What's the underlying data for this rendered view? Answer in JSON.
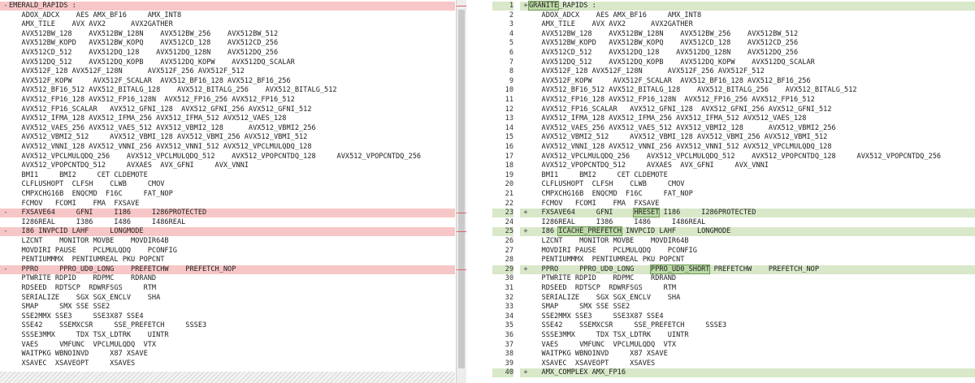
{
  "left_lines": [
    {
      "m": "-",
      "t": "EMERALD_RAPIDS :",
      "c": true
    },
    {
      "m": "",
      "t": "   ADOX_ADCX    AES AMX_BF16     AMX_INT8",
      "c": false
    },
    {
      "m": "",
      "t": "   AMX_TILE    AVX AVX2      AVX2GATHER",
      "c": false
    },
    {
      "m": "",
      "t": "   AVX512BW_128    AVX512BW_128N    AVX512BW_256    AVX512BW_512",
      "c": false
    },
    {
      "m": "",
      "t": "   AVX512BW_KOPD   AVX512BW_KOPQ    AVX512CD_128    AVX512CD_256",
      "c": false
    },
    {
      "m": "",
      "t": "   AVX512CD_512    AVX512DQ_128    AVX512DQ_128N    AVX512DQ_256",
      "c": false
    },
    {
      "m": "",
      "t": "   AVX512DQ_512    AVX512DQ_KOPB    AVX512DQ_KOPW    AVX512DQ_SCALAR",
      "c": false
    },
    {
      "m": "",
      "t": "   AVX512F_128 AVX512F_128N      AVX512F_256 AVX512F_512",
      "c": false
    },
    {
      "m": "",
      "t": "   AVX512F_KOPW     AVX512F_SCALAR  AVX512_BF16_128 AVX512_BF16_256",
      "c": false
    },
    {
      "m": "",
      "t": "   AVX512_BF16_512 AVX512_BITALG_128    AVX512_BITALG_256    AVX512_BITALG_512",
      "c": false
    },
    {
      "m": "",
      "t": "   AVX512_FP16_128 AVX512_FP16_128N  AVX512_FP16_256 AVX512_FP16_512",
      "c": false
    },
    {
      "m": "",
      "t": "   AVX512_FP16_SCALAR   AVX512_GFNI_128  AVX512_GFNI_256 AVX512_GFNI_512",
      "c": false
    },
    {
      "m": "",
      "t": "   AVX512_IFMA_128 AVX512_IFMA_256 AVX512_IFMA_512 AVX512_VAES_128",
      "c": false
    },
    {
      "m": "",
      "t": "   AVX512_VAES_256 AVX512_VAES_512 AVX512_VBMI2_128      AVX512_VBMI2_256",
      "c": false
    },
    {
      "m": "",
      "t": "   AVX512_VBMI2_512     AVX512_VBMI_128 AVX512_VBMI_256 AVX512_VBMI_512",
      "c": false
    },
    {
      "m": "",
      "t": "   AVX512_VNNI_128 AVX512_VNNI_256 AVX512_VNNI_512 AVX512_VPCLMULQDQ_128",
      "c": false
    },
    {
      "m": "",
      "t": "   AVX512_VPCLMULQDQ_256    AVX512_VPCLMULQDQ_512    AVX512_VPOPCNTDQ_128     AVX512_VPOPCNTDQ_256",
      "c": false
    },
    {
      "m": "",
      "t": "   AVX512_VPOPCNTDQ_512     AVXAES  AVX_GFNI     AVX_VNNI",
      "c": false
    },
    {
      "m": "",
      "t": "   BMI1     BMI2     CET CLDEMOTE",
      "c": false
    },
    {
      "m": "",
      "t": "   CLFLUSHOPT  CLFSH    CLWB     CMOV",
      "c": false
    },
    {
      "m": "",
      "t": "   CMPXCHG16B  ENQCMD  F16C     FAT_NOP",
      "c": false
    },
    {
      "m": "",
      "t": "   FCMOV   FCOMI    FMA  FXSAVE",
      "c": false
    },
    {
      "m": "-",
      "t": "   FXSAVE64     GFNI     I186     I286PROTECTED",
      "c": true
    },
    {
      "m": "",
      "t": "   I286REAL     I386     I486     I486REAL",
      "c": false
    },
    {
      "m": "-",
      "t": "   I86 INVPCID LAHF     LONGMODE",
      "c": true
    },
    {
      "m": "",
      "t": "   LZCNT    MONITOR MOVBE    MOVDIR64B",
      "c": false
    },
    {
      "m": "",
      "t": "   MOVDIRI PAUSE    PCLMULQDQ    PCONFIG",
      "c": false
    },
    {
      "m": "",
      "t": "   PENTIUMMMX  PENTIUMREAL PKU POPCNT",
      "c": false
    },
    {
      "m": "-",
      "t": "   PPRO     PPRO_UD0_LONG    PREFETCHW    PREFETCH_NOP",
      "c": true
    },
    {
      "m": "",
      "t": "   PTWRITE RDPID    RDPMC    RDRAND",
      "c": false
    },
    {
      "m": "",
      "t": "   RDSEED  RDTSCP  RDWRFSGS     RTM",
      "c": false
    },
    {
      "m": "",
      "t": "   SERIALIZE    SGX SGX_ENCLV    SHA",
      "c": false
    },
    {
      "m": "",
      "t": "   SMAP     SMX SSE SSE2",
      "c": false
    },
    {
      "m": "",
      "t": "   SSE2MMX SSE3     SSE3X87 SSE4",
      "c": false
    },
    {
      "m": "",
      "t": "   SSE42    SSEMXCSR     SSE_PREFETCH     SSSE3",
      "c": false
    },
    {
      "m": "",
      "t": "   SSSE3MMX     TDX TSX_LDTRK    UINTR",
      "c": false
    },
    {
      "m": "",
      "t": "   VAES     VMFUNC  VPCLMULQDQ  VTX",
      "c": false
    },
    {
      "m": "",
      "t": "   WAITPKG WBNOINVD     X87 XSAVE",
      "c": false
    },
    {
      "m": "",
      "t": "   XSAVEC  XSAVEOPT     XSAVES",
      "c": false
    }
  ],
  "right_lines": [
    {
      "n": "1",
      "m": "+",
      "t": "GRANITE_RAPIDS :",
      "c": true
    },
    {
      "n": "2",
      "m": "",
      "t": "   ADOX_ADCX    AES AMX_BF16     AMX_INT8",
      "c": false
    },
    {
      "n": "3",
      "m": "",
      "t": "   AMX_TILE    AVX AVX2      AVX2GATHER",
      "c": false
    },
    {
      "n": "4",
      "m": "",
      "t": "   AVX512BW_128    AVX512BW_128N    AVX512BW_256    AVX512BW_512",
      "c": false
    },
    {
      "n": "5",
      "m": "",
      "t": "   AVX512BW_KOPD   AVX512BW_KOPQ    AVX512CD_128    AVX512CD_256",
      "c": false
    },
    {
      "n": "6",
      "m": "",
      "t": "   AVX512CD_512    AVX512DQ_128    AVX512DQ_128N    AVX512DQ_256",
      "c": false
    },
    {
      "n": "7",
      "m": "",
      "t": "   AVX512DQ_512    AVX512DQ_KOPB    AVX512DQ_KOPW    AVX512DQ_SCALAR",
      "c": false
    },
    {
      "n": "8",
      "m": "",
      "t": "   AVX512F_128 AVX512F_128N      AVX512F_256 AVX512F_512",
      "c": false
    },
    {
      "n": "9",
      "m": "",
      "t": "   AVX512F_KOPW     AVX512F_SCALAR  AVX512_BF16_128 AVX512_BF16_256",
      "c": false
    },
    {
      "n": "10",
      "m": "",
      "t": "   AVX512_BF16_512 AVX512_BITALG_128    AVX512_BITALG_256    AVX512_BITALG_512",
      "c": false
    },
    {
      "n": "11",
      "m": "",
      "t": "   AVX512_FP16_128 AVX512_FP16_128N  AVX512_FP16_256 AVX512_FP16_512",
      "c": false
    },
    {
      "n": "12",
      "m": "",
      "t": "   AVX512_FP16_SCALAR   AVX512_GFNI_128  AVX512_GFNI_256 AVX512_GFNI_512",
      "c": false
    },
    {
      "n": "13",
      "m": "",
      "t": "   AVX512_IFMA_128 AVX512_IFMA_256 AVX512_IFMA_512 AVX512_VAES_128",
      "c": false
    },
    {
      "n": "14",
      "m": "",
      "t": "   AVX512_VAES_256 AVX512_VAES_512 AVX512_VBMI2_128      AVX512_VBMI2_256",
      "c": false
    },
    {
      "n": "15",
      "m": "",
      "t": "   AVX512_VBMI2_512     AVX512_VBMI_128 AVX512_VBMI_256 AVX512_VBMI_512",
      "c": false
    },
    {
      "n": "16",
      "m": "",
      "t": "   AVX512_VNNI_128 AVX512_VNNI_256 AVX512_VNNI_512 AVX512_VPCLMULQDQ_128",
      "c": false
    },
    {
      "n": "17",
      "m": "",
      "t": "   AVX512_VPCLMULQDQ_256    AVX512_VPCLMULQDQ_512    AVX512_VPOPCNTDQ_128     AVX512_VPOPCNTDQ_256",
      "c": false
    },
    {
      "n": "18",
      "m": "",
      "t": "   AVX512_VPOPCNTDQ_512     AVXAES  AVX_GFNI     AVX_VNNI",
      "c": false
    },
    {
      "n": "19",
      "m": "",
      "t": "   BMI1     BMI2     CET CLDEMOTE",
      "c": false
    },
    {
      "n": "20",
      "m": "",
      "t": "   CLFLUSHOPT  CLFSH    CLWB     CMOV",
      "c": false
    },
    {
      "n": "21",
      "m": "",
      "t": "   CMPXCHG16B  ENQCMD  F16C     FAT_NOP",
      "c": false
    },
    {
      "n": "22",
      "m": "",
      "t": "   FCMOV   FCOMI    FMA  FXSAVE",
      "c": false
    },
    {
      "n": "23",
      "m": "+",
      "t": "   FXSAVE64     GFNI     HRESET I186     I286PROTECTED",
      "c": true
    },
    {
      "n": "24",
      "m": "",
      "t": "   I286REAL     I386     I486     I486REAL",
      "c": false
    },
    {
      "n": "25",
      "m": "+",
      "t": "   I86 ICACHE_PREFETCH INVPCID LAHF     LONGMODE",
      "c": true
    },
    {
      "n": "26",
      "m": "",
      "t": "   LZCNT    MONITOR MOVBE    MOVDIR64B",
      "c": false
    },
    {
      "n": "27",
      "m": "",
      "t": "   MOVDIRI PAUSE    PCLMULQDQ    PCONFIG",
      "c": false
    },
    {
      "n": "28",
      "m": "",
      "t": "   PENTIUMMMX  PENTIUMREAL PKU POPCNT",
      "c": false
    },
    {
      "n": "29",
      "m": "+",
      "t": "   PPRO     PPRO_UD0_LONG    PPRO_UD0_SHORT PREFETCHW    PREFETCH_NOP",
      "c": true
    },
    {
      "n": "30",
      "m": "",
      "t": "   PTWRITE RDPID    RDPMC    RDRAND",
      "c": false
    },
    {
      "n": "31",
      "m": "",
      "t": "   RDSEED  RDTSCP  RDWRFSGS     RTM",
      "c": false
    },
    {
      "n": "32",
      "m": "",
      "t": "   SERIALIZE    SGX SGX_ENCLV    SHA",
      "c": false
    },
    {
      "n": "33",
      "m": "",
      "t": "   SMAP     SMX SSE SSE2",
      "c": false
    },
    {
      "n": "34",
      "m": "",
      "t": "   SSE2MMX SSE3     SSE3X87 SSE4",
      "c": false
    },
    {
      "n": "35",
      "m": "",
      "t": "   SSE42    SSEMXCSR     SSE_PREFETCH     SSSE3",
      "c": false
    },
    {
      "n": "36",
      "m": "",
      "t": "   SSSE3MMX     TDX TSX_LDTRK    UINTR",
      "c": false
    },
    {
      "n": "37",
      "m": "",
      "t": "   VAES     VMFUNC  VPCLMULQDQ  VTX",
      "c": false
    },
    {
      "n": "38",
      "m": "",
      "t": "   WAITPKG WBNOINVD     X87 XSAVE",
      "c": false
    },
    {
      "n": "39",
      "m": "",
      "t": "   XSAVEC  XSAVEOPT     XSAVES",
      "c": false
    },
    {
      "n": "40",
      "m": "+",
      "t": "   AMX_COMPLEX AMX_FP16",
      "c": true
    }
  ],
  "highlights": [
    "GRANITE",
    "HRESET",
    "ICACHE_PREFETCH",
    "PPRO_UD0_SHORT"
  ],
  "colors": {
    "removed_bg": "#f7c6c6",
    "added_bg": "#d8e8c9",
    "inline_add": "#bcd9a6"
  }
}
